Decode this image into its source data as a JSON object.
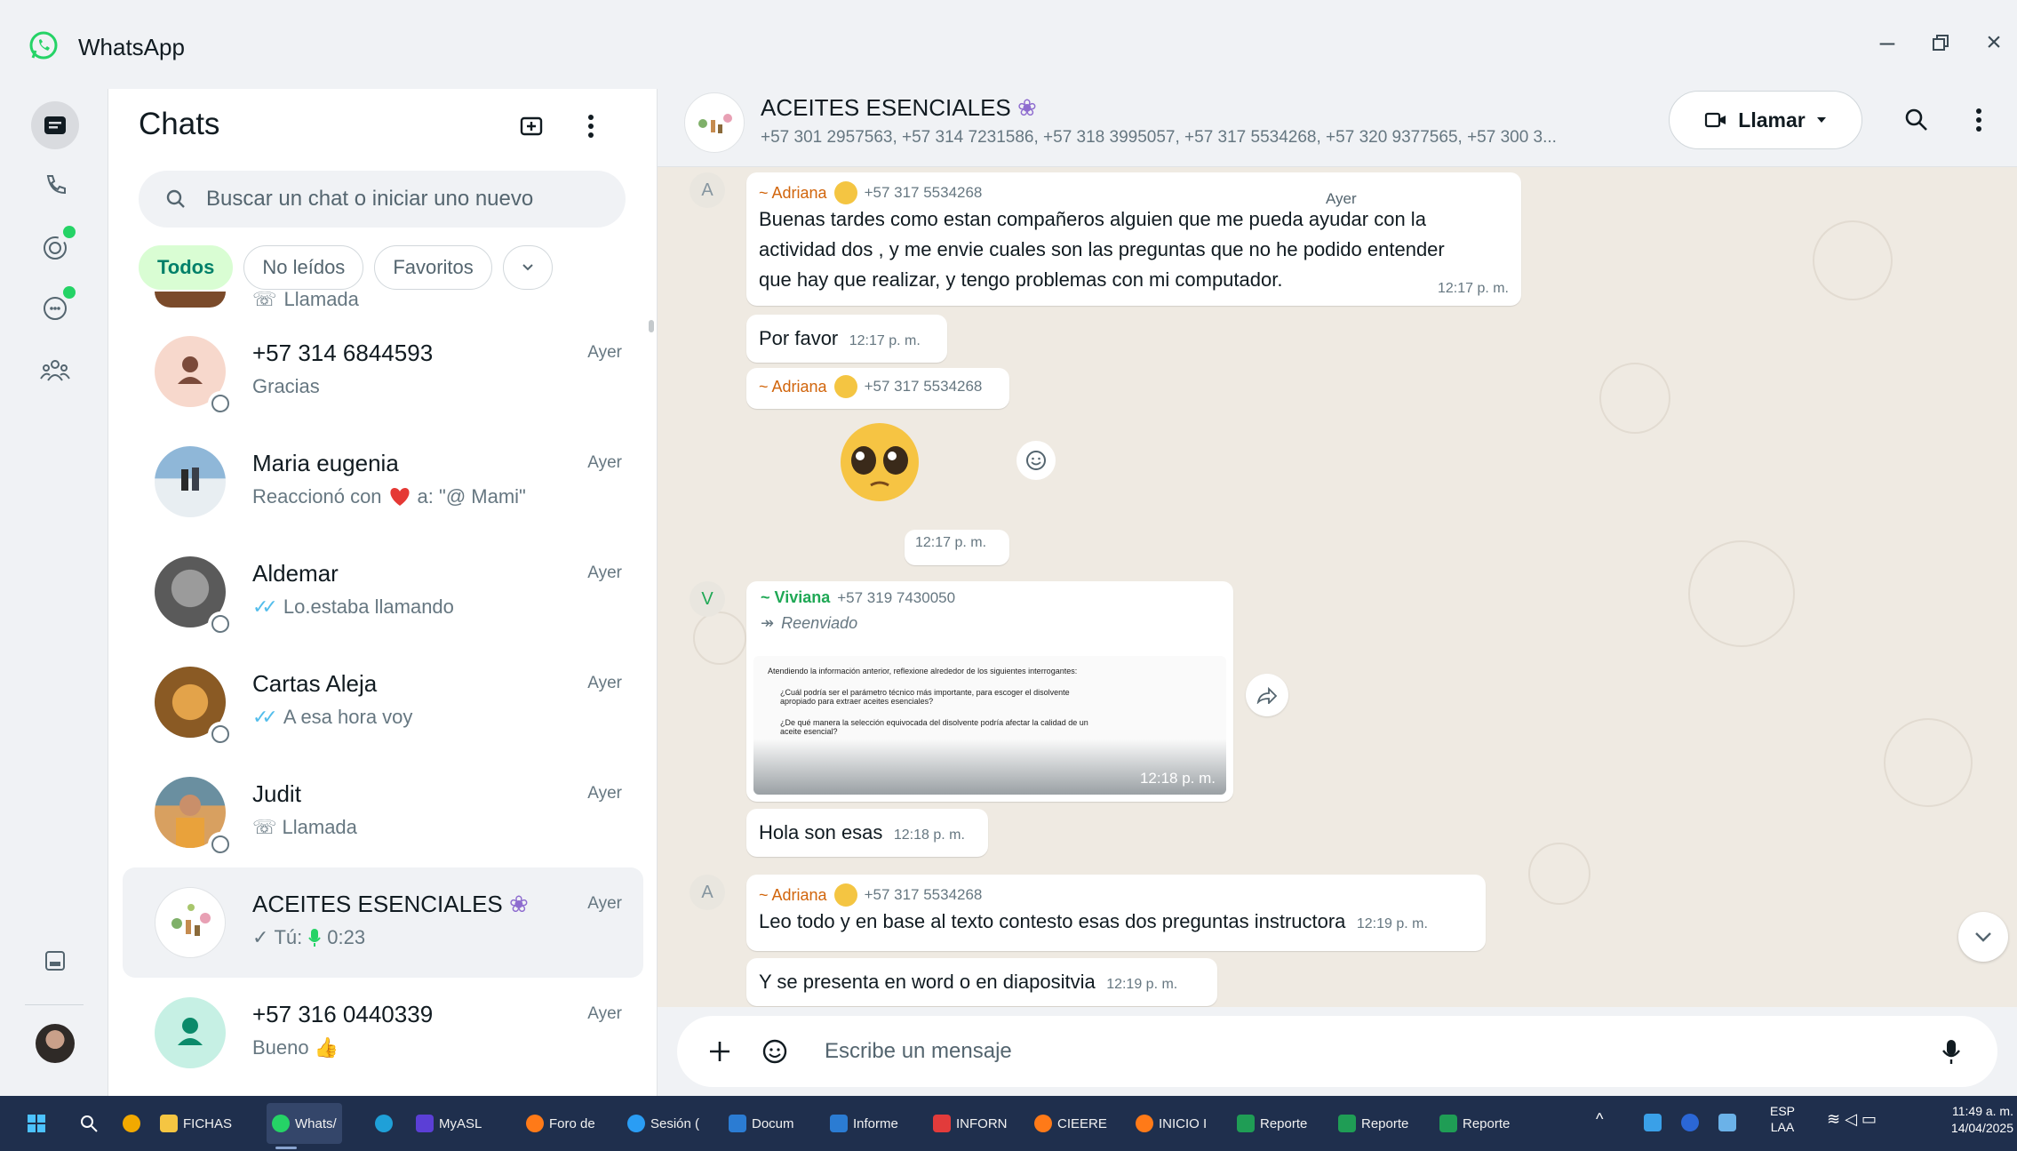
{
  "app": {
    "title": "WhatsApp"
  },
  "chatlist": {
    "title": "Chats",
    "search_placeholder": "Buscar un chat o iniciar uno nuevo",
    "filters": [
      "Todos",
      "No leídos",
      "Favoritos"
    ],
    "partial_top_preview": "Llamada",
    "items": [
      {
        "name": "+57 314 6844593",
        "preview": "Gracias",
        "time": "Ayer"
      },
      {
        "name": "Maria eugenia",
        "preview_a": "Reaccionó con",
        "preview_b": "a: \"@ Mami\"",
        "time": "Ayer"
      },
      {
        "name": "Aldemar",
        "preview": "Lo.estaba llamando",
        "time": "Ayer"
      },
      {
        "name": "Cartas Aleja",
        "preview": "A esa hora voy",
        "time": "Ayer"
      },
      {
        "name": "Judit",
        "preview": "Llamada",
        "time": "Ayer"
      },
      {
        "name": "ACEITES ESENCIALES",
        "preview_a": "Tú:",
        "preview_b": "0:23",
        "time": "Ayer"
      },
      {
        "name": "+57 316 0440339",
        "preview": "Bueno",
        "time": "Ayer"
      }
    ]
  },
  "chat": {
    "name": "ACEITES ESENCIALES",
    "members": "+57 301 2957563, +57 314 7231586, +57 318 3995057, +57 317 5534268, +57 320 9377565, +57 300 3...",
    "call_label": "Llamar",
    "date_chip": "Ayer",
    "messages": {
      "m1_sender": "~ Adriana",
      "m1_phone": "+57 317 5534268",
      "m1_line1": "Buenas tardes como estan compañeros alguien que me pueda ayudar con la",
      "m1_line2": "actividad dos , y me envie cuales son las preguntas que no he podido entender",
      "m1_line3": "que hay que realizar, y tengo problemas con mi computador.",
      "m1_time": "12:17 p. m.",
      "m2_text": "Por favor",
      "m2_time": "12:17 p. m.",
      "m3_sender": "~ Adriana",
      "m3_phone": "+57 317 5534268",
      "m3_time": "12:17 p. m.",
      "m4_badge": "V",
      "m4_sender": "~ Viviana",
      "m4_phone": "+57 319 7430050",
      "m4_forwarded": "Reenviado",
      "m4_img_line1": "Atendiendo la información anterior, reflexione alrededor de los siguientes interrogantes:",
      "m4_img_line2": "¿Cuál podría ser el parámetro técnico más importante, para escoger el disolvente",
      "m4_img_line3": "apropiado para extraer aceites esenciales?",
      "m4_img_line4": "¿De qué manera la selección equivocada del disolvente podría afectar la calidad de un",
      "m4_img_line5": "aceite esencial?",
      "m4_time": "12:18 p. m.",
      "m5_text": "Hola son esas",
      "m5_time": "12:18 p. m.",
      "m6_badge": "A",
      "m6_sender": "~ Adriana",
      "m6_phone": "+57 317 5534268",
      "m6_text": "Leo todo y en base al texto contesto esas dos preguntas instructora",
      "m6_time": "12:19 p. m.",
      "m7_text": "Y se presenta en word o en diapositvia",
      "m7_time": "12:19 p. m.",
      "m1_badge": "A"
    }
  },
  "composer": {
    "placeholder": "Escribe un mensaje"
  },
  "taskbar": {
    "items": [
      "FICHAS",
      "Whats/",
      "MyASL",
      "Foro de",
      "Sesión (",
      "Docum",
      "Informe",
      "INFORN",
      "CIEERE",
      "INICIO I",
      "Reporte",
      "Reporte",
      "Reporte"
    ],
    "lang_top": "ESP",
    "lang_bottom": "LAA",
    "time": "11:49 a. m.",
    "date": "14/04/2025"
  },
  "colors": {
    "accent": "#008069",
    "brand_green": "#25d366",
    "sender_orange": "#d1650c",
    "viviana_green": "#1fa855",
    "taskbar": "#1f2f4d"
  }
}
